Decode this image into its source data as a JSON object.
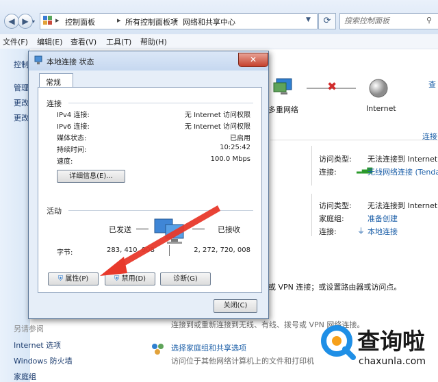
{
  "explorer": {
    "address": {
      "crumbs": [
        "控制面板",
        "所有控制面板项",
        "网络和共享中心"
      ]
    },
    "search_placeholder": "搜索控制面板",
    "menu": [
      "文件(F)",
      "编辑(E)",
      "查看(V)",
      "工具(T)",
      "帮助(H)"
    ],
    "left_links": [
      "控制",
      "管理",
      "更改",
      "更改"
    ],
    "see_also": {
      "heading": "另请参阅",
      "items": [
        "Internet 选项",
        "Windows 防火墙",
        "家庭组"
      ]
    },
    "network_map": {
      "view_full": "查",
      "node_multi": "多重网络",
      "node_internet": "Internet"
    },
    "connect_link": "连接",
    "networks": [
      {
        "access_type_label": "访问类型:",
        "access_type_value": "无法连接到 Internet",
        "conn_label": "连接:",
        "conn_value": "无线网络连接 (Tenda"
      },
      {
        "access_type_label": "访问类型:",
        "access_type_value": "无法连接到 Internet",
        "homegroup_label": "家庭组:",
        "homegroup_value": "准备创建",
        "conn_label": "连接:",
        "conn_value": "本地连接"
      }
    ],
    "change_settings_text": "或 VPN 连接；或设置路由器或访问点。",
    "reconnect_text": "连接到或重新连接到无线、有线、拨号或 VPN 网络连接。",
    "homegroup_task": {
      "title": "选择家庭组和共享选项",
      "desc": "访问位于其他网络计算机上的文件和打印机"
    }
  },
  "dialog": {
    "title": "本地连接 状态",
    "close": "✕",
    "tab": "常规",
    "connection": {
      "heading": "连接",
      "rows": [
        {
          "label": "IPv4 连接:",
          "value": "无 Internet 访问权限"
        },
        {
          "label": "IPv6 连接:",
          "value": "无 Internet 访问权限"
        },
        {
          "label": "媒体状态:",
          "value": "已启用"
        },
        {
          "label": "持续时间:",
          "value": "10:25:42"
        },
        {
          "label": "速度:",
          "value": "100.0 Mbps"
        }
      ],
      "details_button": "详细信息(E)..."
    },
    "activity": {
      "heading": "活动",
      "sent_label": "已发送",
      "received_label": "已接收",
      "bytes_label": "字节:",
      "bytes_sent": "283, 410, 908",
      "bytes_received": "2, 272, 720, 008"
    },
    "buttons": {
      "properties": "属性(P)",
      "disable": "禁用(D)",
      "diagnose": "诊断(G)",
      "close": "关闭(C)"
    }
  },
  "watermark": {
    "brand": "查询啦",
    "domain": "chaxunla.com"
  },
  "colors": {
    "link": "#1c5fa8",
    "arrow": "#e8392b",
    "watermark_blue": "#1f8fe6",
    "watermark_orange": "#f6a01a"
  }
}
